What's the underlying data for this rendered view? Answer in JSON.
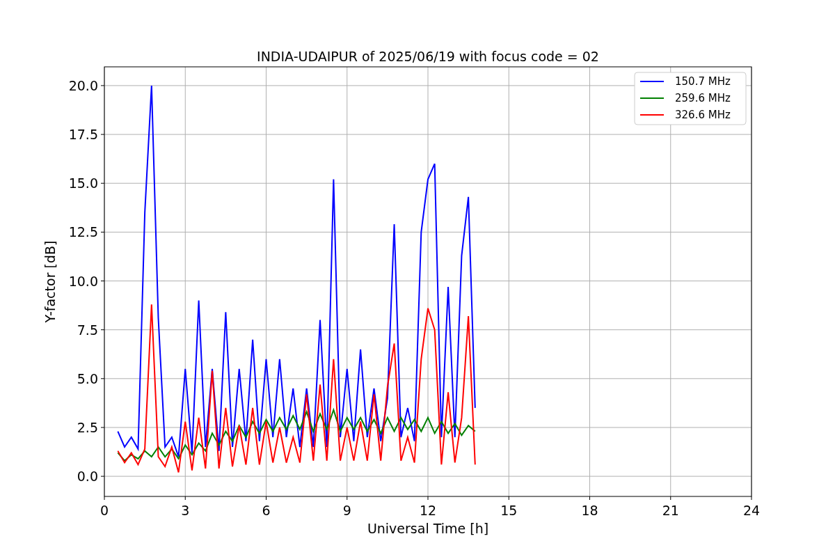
{
  "chart_data": {
    "type": "line",
    "title": "INDIA-UDAIPUR of 2025/06/19 with focus code = 02",
    "xlabel": "Universal Time [h]",
    "ylabel": "Y-factor [dB]",
    "x": [
      0.5,
      0.75,
      1,
      1.25,
      1.5,
      1.75,
      2,
      2.25,
      2.5,
      2.75,
      3,
      3.25,
      3.5,
      3.75,
      4,
      4.25,
      4.5,
      4.75,
      5,
      5.25,
      5.5,
      5.75,
      6,
      6.25,
      6.5,
      6.75,
      7,
      7.25,
      7.5,
      7.75,
      8,
      8.25,
      8.5,
      8.75,
      9,
      9.25,
      9.5,
      9.75,
      10,
      10.25,
      10.5,
      10.75,
      11,
      11.25,
      11.5,
      11.75,
      12,
      12.25,
      12.5,
      12.75,
      13,
      13.25,
      13.5,
      13.75
    ],
    "series": [
      {
        "name": "150.7 MHz",
        "color": "#0000ff",
        "values": [
          2.3,
          1.5,
          2.0,
          1.4,
          13.5,
          20.0,
          8.1,
          1.5,
          2.0,
          1.0,
          5.5,
          1.2,
          9.0,
          1.5,
          5.5,
          1.3,
          8.4,
          1.5,
          5.5,
          1.8,
          7.0,
          1.8,
          6.0,
          2.0,
          6.0,
          2.0,
          4.5,
          1.5,
          4.5,
          1.5,
          8.0,
          1.5,
          15.2,
          2.0,
          5.5,
          1.8,
          6.5,
          2.0,
          4.5,
          1.8,
          4.0,
          12.9,
          2.0,
          3.5,
          1.8,
          12.5,
          15.2,
          16.0,
          2.0,
          9.7,
          2.0,
          11.3,
          14.3,
          3.5
        ]
      },
      {
        "name": "259.6 MHz",
        "color": "#008000",
        "values": [
          1.2,
          0.8,
          1.1,
          0.9,
          1.3,
          1.0,
          1.5,
          1.0,
          1.4,
          0.9,
          1.6,
          1.1,
          1.7,
          1.3,
          2.2,
          1.6,
          2.3,
          1.8,
          2.6,
          2.0,
          2.8,
          2.2,
          2.9,
          2.3,
          3.0,
          2.4,
          3.1,
          2.4,
          3.3,
          2.3,
          3.2,
          2.4,
          3.4,
          2.3,
          3.0,
          2.4,
          3.0,
          2.3,
          2.9,
          2.2,
          3.0,
          2.3,
          3.0,
          2.4,
          2.9,
          2.3,
          3.0,
          2.2,
          2.8,
          2.2,
          2.7,
          2.1,
          2.6,
          2.3
        ]
      },
      {
        "name": "326.6 MHz",
        "color": "#ff0000",
        "values": [
          1.3,
          0.7,
          1.2,
          0.6,
          1.4,
          8.8,
          1.0,
          0.5,
          1.5,
          0.2,
          2.8,
          0.3,
          3.0,
          0.4,
          5.4,
          0.4,
          3.5,
          0.5,
          2.6,
          0.6,
          3.5,
          0.6,
          2.8,
          0.7,
          2.5,
          0.7,
          2.0,
          0.7,
          4.2,
          0.8,
          4.7,
          0.8,
          6.0,
          0.8,
          2.5,
          0.8,
          2.8,
          0.8,
          4.2,
          0.8,
          4.6,
          6.8,
          0.8,
          2.0,
          0.7,
          6.0,
          8.6,
          7.5,
          0.6,
          4.3,
          0.7,
          3.0,
          8.2,
          0.6
        ]
      }
    ],
    "xlim": [
      0,
      24
    ],
    "ylim": [
      -1.03,
      20.96
    ],
    "xticks": [
      0,
      3,
      6,
      9,
      12,
      15,
      18,
      21,
      24
    ],
    "yticks": [
      {
        "value": 0,
        "label": "0.0"
      },
      2.5,
      {
        "value": 5,
        "label": "5.0"
      },
      7.5,
      {
        "value": 10,
        "label": "10.0"
      },
      12.5,
      {
        "value": 15,
        "label": "15.0"
      },
      17.5,
      {
        "value": 20,
        "label": "20.0"
      }
    ],
    "grid": true,
    "legend": true
  }
}
